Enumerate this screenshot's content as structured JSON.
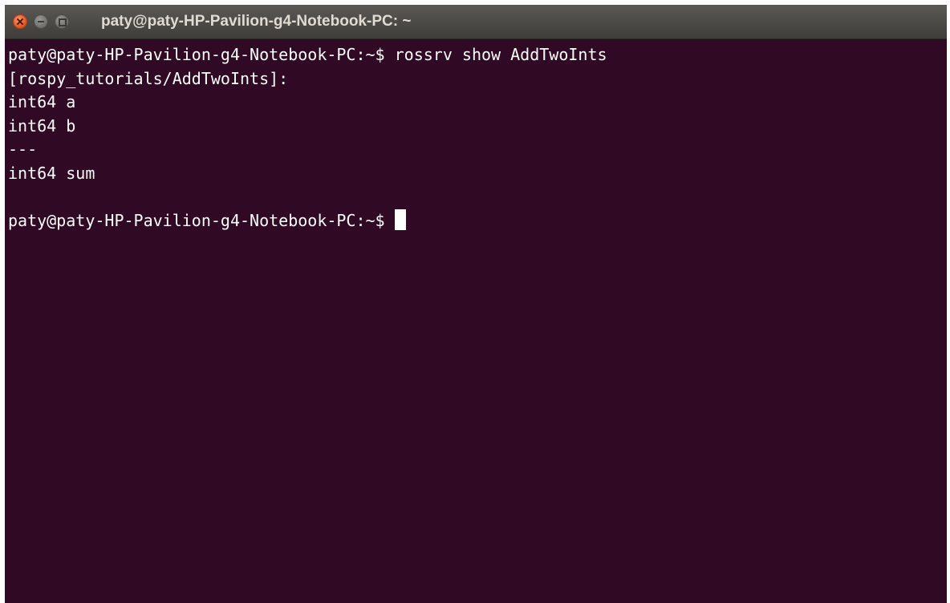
{
  "window": {
    "title": "paty@paty-HP-Pavilion-g4-Notebook-PC: ~"
  },
  "terminal": {
    "lines": [
      "paty@paty-HP-Pavilion-g4-Notebook-PC:~$ rossrv show AddTwoInts",
      "[rospy_tutorials/AddTwoInts]:",
      "int64 a",
      "int64 b",
      "---",
      "int64 sum",
      ""
    ],
    "prompt": "paty@paty-HP-Pavilion-g4-Notebook-PC:~$ "
  },
  "colors": {
    "background": "#300a24",
    "foreground": "#ffffff",
    "titlebar": "#4c4b47",
    "close_button": "#e2501c"
  }
}
